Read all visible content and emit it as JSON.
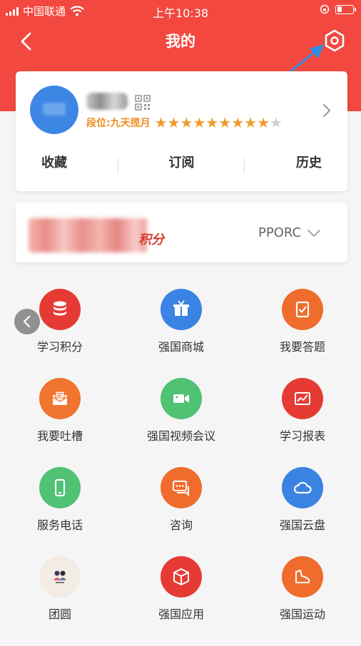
{
  "status_bar": {
    "carrier": "中国联通",
    "time": "上午10:38"
  },
  "nav": {
    "title": "我的"
  },
  "profile": {
    "rank_label": "段位:九天揽月",
    "stars_total": 10,
    "stars_filled": 9,
    "tabs": [
      "收藏",
      "订阅",
      "历史"
    ]
  },
  "points": {
    "label": "积分",
    "selector": "PPORC"
  },
  "grid": [
    {
      "label": "学习积分",
      "icon": "database-icon",
      "color": "#e63b35"
    },
    {
      "label": "强国商城",
      "icon": "gift-box-icon",
      "color": "#3b83e2"
    },
    {
      "label": "我要答题",
      "icon": "clipboard-check-icon",
      "color": "#f06c2d"
    },
    {
      "label": "我要吐槽",
      "icon": "mail-icon",
      "color": "#f0752f"
    },
    {
      "label": "强国视频会议",
      "icon": "video-camera-icon",
      "color": "#4fc274"
    },
    {
      "label": "学习报表",
      "icon": "chart-icon",
      "color": "#e63b35"
    },
    {
      "label": "服务电话",
      "icon": "phone-icon",
      "color": "#4fc274"
    },
    {
      "label": "咨询",
      "icon": "chat-icon",
      "color": "#f06c2d"
    },
    {
      "label": "强国云盘",
      "icon": "cloud-icon",
      "color": "#3b83e2"
    },
    {
      "label": "团圆",
      "icon": "family-icon",
      "color": "#f3ece4"
    },
    {
      "label": "强国应用",
      "icon": "cube-icon",
      "color": "#e63b35"
    },
    {
      "label": "强国运动",
      "icon": "shoe-icon",
      "color": "#f06c2d"
    }
  ]
}
